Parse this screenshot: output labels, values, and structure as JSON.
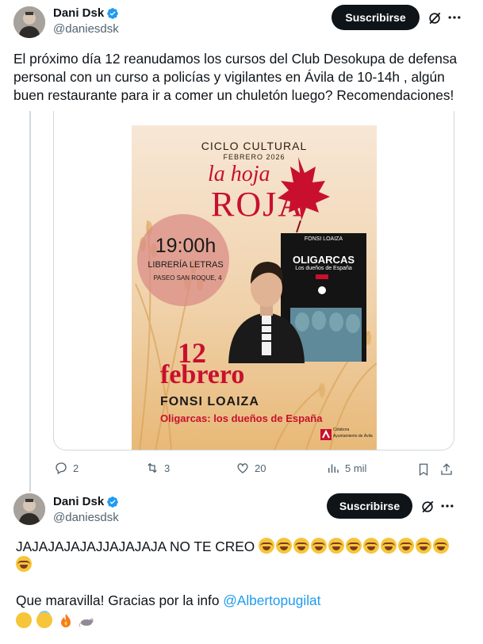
{
  "post1": {
    "author_name": "Dani Dsk",
    "author_handle": "@daniesdsk",
    "subscribe_label": "Suscribirse",
    "text": "El próximo día 12 reanudamos los cursos del Club Desokupa de defensa personal con un curso a policías y vigilantes en Ávila de 10-14h , algún buen restaurante para ir a comer un chuletón luego? Recomendaciones!"
  },
  "poster": {
    "cycle": "CICLO CULTURAL",
    "month": "FEBRERO 2026",
    "brand_top": "la hoja",
    "brand_bottom": "ROJA",
    "time": "19:00h",
    "venue": "LIBRERÍA LETRAS",
    "address": "PASEO SAN ROQUE, 4",
    "book_author": "FONSI LOAIZA",
    "book_title": "OLIGARCAS",
    "book_subtitle": "Los dueños de España",
    "day": "12",
    "month_day": "febrero",
    "speaker": "FONSI LOAIZA",
    "talk_title": "Oligarcas: los dueños de España",
    "sponsor": "Ayuntamiento de Ávila",
    "sponsor_tag": "Colabora"
  },
  "actions": {
    "replies": "2",
    "reposts": "3",
    "likes": "20",
    "views": "5 mil"
  },
  "post2": {
    "author_name": "Dani Dsk",
    "author_handle": "@daniesdsk",
    "subscribe_label": "Suscribirse",
    "line1": "JAJAJAJAJAJJAJAJAJA NO TE CREO",
    "line2_prefix": "Que maravilla! Gracias por la info ",
    "mention": "@Albertopugilat"
  },
  "colors": {
    "accent": "#1d9bf0",
    "poster_red": "#c8102e",
    "poster_bg": "#f3dcc0"
  },
  "icons": [
    "verified-badge-icon",
    "grok-icon",
    "more-icon",
    "reply-icon",
    "repost-icon",
    "like-icon",
    "views-icon",
    "bookmark-icon",
    "share-icon"
  ]
}
